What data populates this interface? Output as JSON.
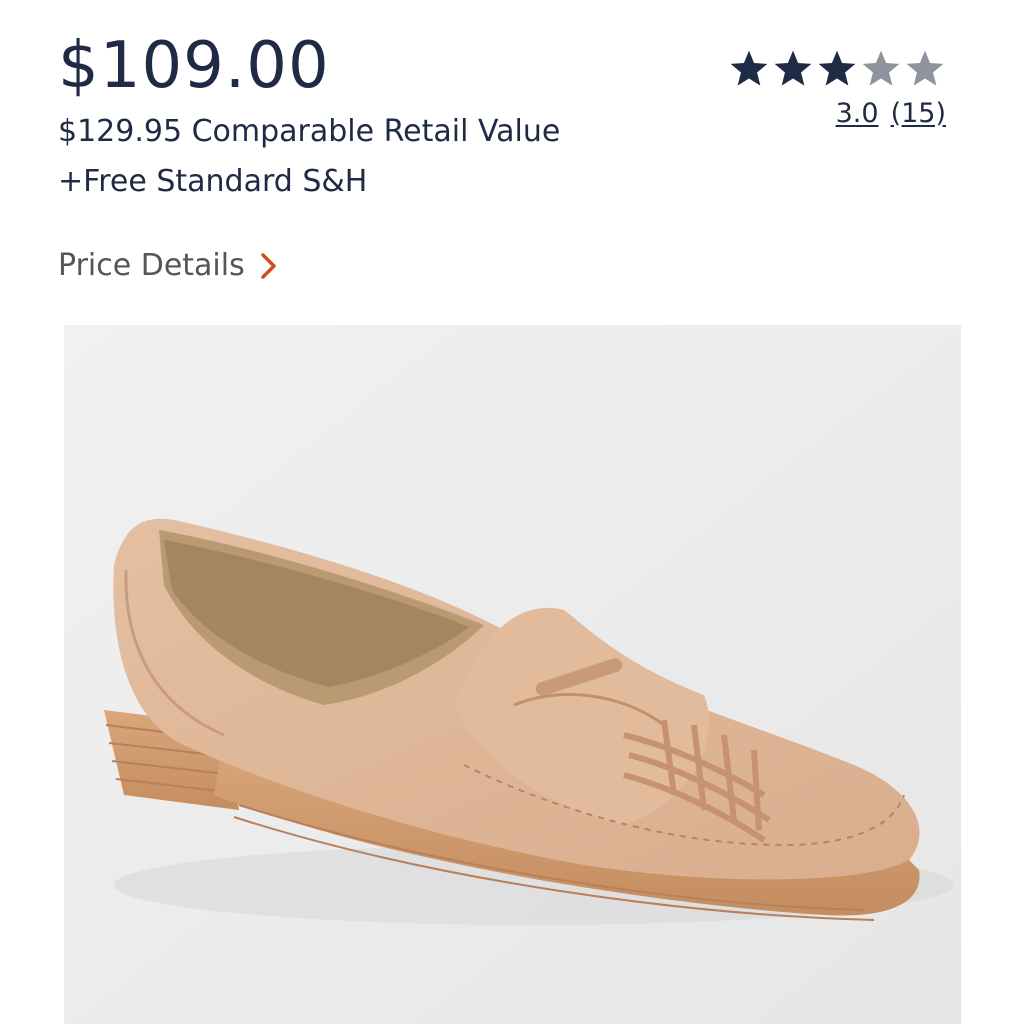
{
  "product": {
    "price": "$109.00",
    "comparable_retail": "$129.95 Comparable Retail Value",
    "shipping": "+Free Standard S&H",
    "price_details_label": "Price Details"
  },
  "rating": {
    "stars": 3,
    "max_stars": 5,
    "average": "3.0",
    "count": "(15)",
    "filled_color": "#1f2a44",
    "empty_color": "#8e939e"
  },
  "image": {
    "icon": "product-image-loafer",
    "background": "#ededed"
  },
  "colors": {
    "text_primary": "#1f2a44",
    "text_secondary": "#555555",
    "accent_chevron": "#d14b23"
  }
}
